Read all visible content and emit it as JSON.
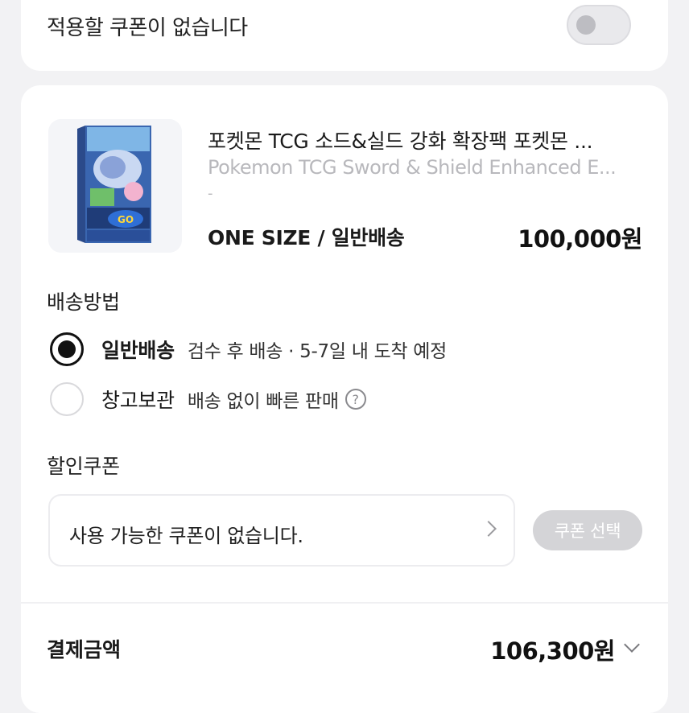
{
  "coupon_toggle": {
    "label": "적용할 쿠폰이 없습니다",
    "enabled": false
  },
  "product": {
    "title": "포켓몬 TCG 소드&실드 강화 확장팩 포켓몬 ...",
    "subtitle": "Pokemon TCG Sword & Shield Enhanced E...",
    "extra": "-",
    "option": "ONE SIZE / 일반배송",
    "price": "100,000원",
    "image_icon": "pokemon-card-box"
  },
  "shipping": {
    "section_label": "배송방법",
    "options": [
      {
        "label": "일반배송",
        "desc": "검수 후 배송 · 5-7일 내 도착 예정",
        "selected": true
      },
      {
        "label": "창고보관",
        "desc": "배송 없이 빠른 판매",
        "selected": false,
        "help": "?"
      }
    ]
  },
  "coupon": {
    "section_label": "할인쿠폰",
    "text": "사용 가능한 쿠폰이 없습니다.",
    "button_label": "쿠폰 선택"
  },
  "payment": {
    "label": "결제금액",
    "amount": "106,300원"
  },
  "colors": {
    "background": "#f2f2f4",
    "card": "#ffffff",
    "disabled_button": "#d4d4d7"
  }
}
